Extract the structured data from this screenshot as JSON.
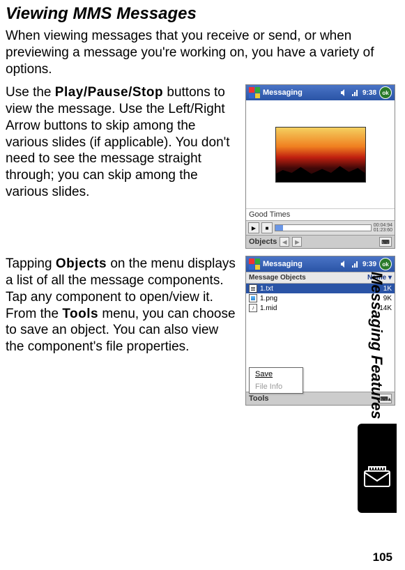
{
  "heading": "Viewing MMS Messages",
  "intro": "When viewing messages that you receive or send, or when previewing a message you're working on, you have a variety of options.",
  "para1_a": "Use the ",
  "para1_bold": "Play/Pause/Stop",
  "para1_b": " buttons to view the message. Use the Left/Right Arrow buttons to skip among the various slides (if applicable). You don't need to see the message straight through; you can skip among the various slides.",
  "para2_a": "Tapping ",
  "para2_bold1": "Objects",
  "para2_b": " on the menu displays a list of all the message components. Tap any component to open/view it. From the ",
  "para2_bold2": "Tools",
  "para2_c": " menu, you can choose to save an object. You can also view the component's file properties.",
  "shot1": {
    "app_title": "Messaging",
    "clock": "9:38",
    "ok": "ok",
    "caption": "Good Times",
    "time1": "00:04:94",
    "time2": "01:23:60",
    "menu": "Objects"
  },
  "shot2": {
    "app_title": "Messaging",
    "clock": "9:39",
    "ok": "ok",
    "header_left": "Message Objects",
    "header_right": "Name ▾",
    "rows": [
      {
        "name": "1.txt",
        "size": "1K"
      },
      {
        "name": "1.png",
        "size": "9K"
      },
      {
        "name": "1.mid",
        "size": "14K"
      }
    ],
    "popup_save": "Save",
    "popup_info": "File Info",
    "menu": "Tools"
  },
  "sidebar": "Messaging Features",
  "page_number": "105"
}
